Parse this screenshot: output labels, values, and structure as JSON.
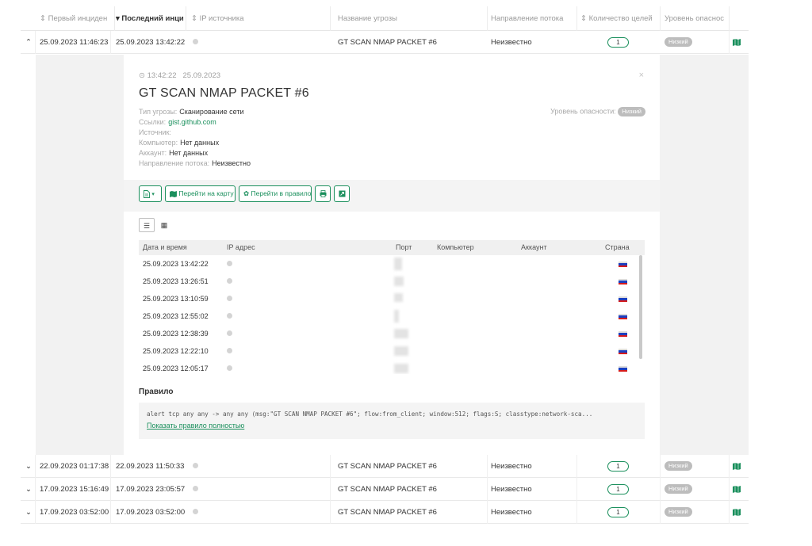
{
  "columns": {
    "first_incident": "Первый инциден",
    "last_incident": "Последний инци",
    "source_ip": "IP источника",
    "threat_name": "Название угрозы",
    "flow_direction": "Направление потока",
    "targets_count": "Количество целей",
    "danger_level": "Уровень опаснос"
  },
  "rows": [
    {
      "expand": "^",
      "first": "25.09.2023 11:46:23",
      "last": "25.09.2023 13:42:22",
      "threat": "GT SCAN NMAP PACKET #6",
      "direction": "Неизвестно",
      "count": "1",
      "level": "Низкий"
    },
    {
      "expand": "v",
      "first": "22.09.2023 01:17:38",
      "last": "22.09.2023 11:50:33",
      "threat": "GT SCAN NMAP PACKET #6",
      "direction": "Неизвестно",
      "count": "1",
      "level": "Низкий"
    },
    {
      "expand": "v",
      "first": "17.09.2023 15:16:49",
      "last": "17.09.2023 23:05:57",
      "threat": "GT SCAN NMAP PACKET #6",
      "direction": "Неизвестно",
      "count": "1",
      "level": "Низкий"
    },
    {
      "expand": "v",
      "first": "17.09.2023 03:52:00",
      "last": "17.09.2023 03:52:00",
      "threat": "GT SCAN NMAP PACKET #6",
      "direction": "Неизвестно",
      "count": "1",
      "level": "Низкий"
    }
  ],
  "detail": {
    "time": "13:42:22",
    "date": "25.09.2023",
    "close": "×",
    "title": "GT SCAN NMAP PACKET #6",
    "props": {
      "threat_type_key": "Тип угрозы:",
      "threat_type_val": "Сканирование сети",
      "links_key": "Ссылки:",
      "links_val": "gist.github.com",
      "source_key": "Источник:",
      "computer_key": "Компьютер:",
      "computer_val": "Нет данных",
      "account_key": "Аккаунт:",
      "account_val": "Нет данных",
      "direction_key": "Направление потока:",
      "direction_val": "Неизвестно"
    },
    "level_key": "Уровень опасности:",
    "level_val": "Низкий",
    "toolbar": {
      "goto_map": "Перейти на карту",
      "goto_rule": "Перейти в правило"
    },
    "sub_columns": {
      "datetime": "Дата и время",
      "ip": "IP адрес",
      "port": "Порт",
      "computer": "Компьютер",
      "account": "Аккаунт",
      "country": "Страна"
    },
    "sub_rows": [
      {
        "datetime": "25.09.2023 13:42:22"
      },
      {
        "datetime": "25.09.2023 13:26:51"
      },
      {
        "datetime": "25.09.2023 13:10:59"
      },
      {
        "datetime": "25.09.2023 12:55:02"
      },
      {
        "datetime": "25.09.2023 12:38:39"
      },
      {
        "datetime": "25.09.2023 12:22:10"
      },
      {
        "datetime": "25.09.2023 12:05:17"
      }
    ],
    "rule_title": "Правило",
    "rule_code": "alert tcp any any -> any any (msg:\"GT SCAN NMAP PACKET #6\"; flow:from_client; window:512; flags:S; classtype:network-sca...",
    "rule_link": "Показать правило полностью"
  },
  "colors": {
    "accent": "#1a8f5c",
    "badge": "#bdbdbd",
    "panel_bg": "#f2f2f2"
  },
  "icons": [
    "sort-icon",
    "sort-desc-icon",
    "chevron-up-icon",
    "chevron-down-icon",
    "status-dot-icon",
    "map-icon",
    "clock-icon",
    "close-icon",
    "report-icon",
    "caret-down-icon",
    "gear-icon",
    "print-icon",
    "export-icon",
    "list-view-icon",
    "grid-view-icon",
    "flag-ru-icon"
  ]
}
